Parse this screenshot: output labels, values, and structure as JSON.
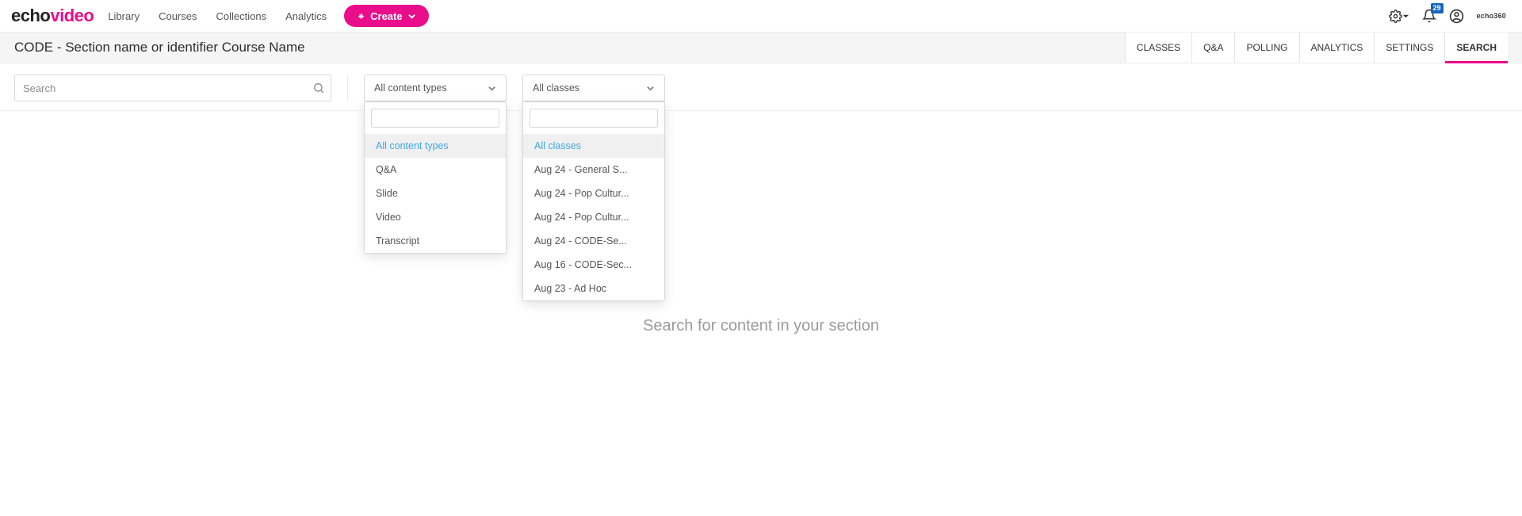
{
  "logo": {
    "part1": "echo",
    "part2": "video"
  },
  "nav": {
    "library": "Library",
    "courses": "Courses",
    "collections": "Collections",
    "analytics": "Analytics"
  },
  "create_button": "Create",
  "notifications_count": "29",
  "brand_mini": "echo360",
  "course_title": "CODE - Section name or identifier Course Name",
  "tabs": {
    "classes": "CLASSES",
    "qa": "Q&A",
    "polling": "POLLING",
    "analytics": "ANALYTICS",
    "settings": "SETTINGS",
    "search": "SEARCH"
  },
  "search": {
    "placeholder": "Search"
  },
  "content_type_filter": {
    "label": "All content types",
    "options": {
      "all": "All content types",
      "qa": "Q&A",
      "slide": "Slide",
      "video": "Video",
      "transcript": "Transcript"
    }
  },
  "class_filter": {
    "label": "All classes",
    "options": {
      "all": "All classes",
      "o1": "Aug 24 - General S...",
      "o2": "Aug 24 - Pop Cultur...",
      "o3": "Aug 24 - Pop Cultur...",
      "o4": "Aug 24 - CODE-Se...",
      "o5": "Aug 16 - CODE-Sec...",
      "o6": "Aug 23 - Ad Hoc"
    }
  },
  "empty_state": "Search for content in your section"
}
